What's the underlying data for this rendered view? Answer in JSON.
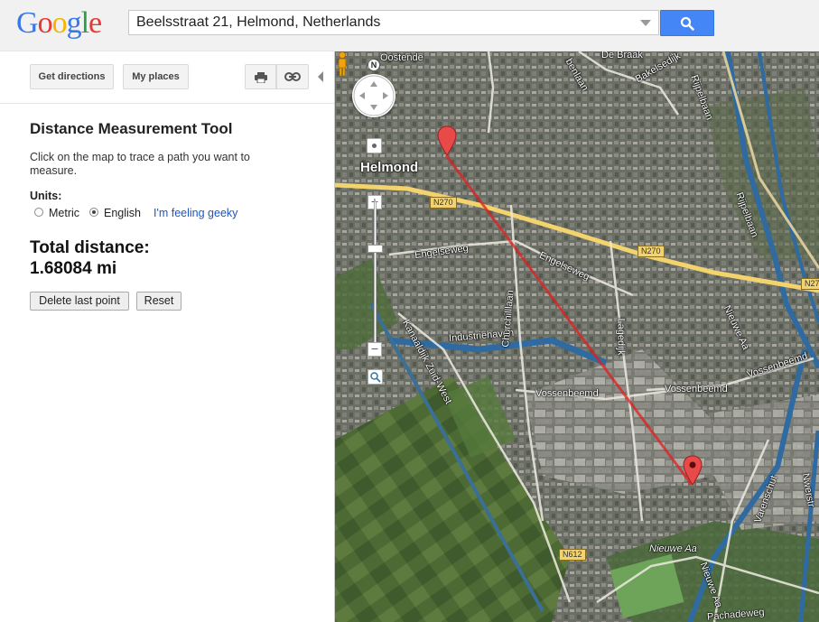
{
  "header": {
    "logo_letters": [
      {
        "char": "G",
        "color": "#3b78e7"
      },
      {
        "char": "o",
        "color": "#e53935"
      },
      {
        "char": "o",
        "color": "#f5b400"
      },
      {
        "char": "g",
        "color": "#3b78e7"
      },
      {
        "char": "l",
        "color": "#2e9e45"
      },
      {
        "char": "e",
        "color": "#e53935"
      }
    ],
    "search_value": "Beelsstraat 21, Helmond, Netherlands",
    "search_button_icon": "search-icon"
  },
  "panel": {
    "get_directions_label": "Get directions",
    "my_places_label": "My places",
    "print_icon": "printer-icon",
    "link_icon": "link-icon",
    "tool_title": "Distance Measurement Tool",
    "instructions": "Click on the map to trace a path you want to measure.",
    "units_label": "Units:",
    "unit_options": [
      "Metric",
      "English"
    ],
    "unit_selected": "English",
    "geeky_link": "I'm feeling geeky",
    "total_label": "Total distance:",
    "total_value": "1.68084 mi",
    "delete_last_label": "Delete last point",
    "reset_label": "Reset"
  },
  "map": {
    "compass_label": "N",
    "zoom_in_symbol": "+",
    "zoom_out_symbol": "−",
    "labels": {
      "oostende": "Oostende",
      "helmond": "Helmond",
      "n270a": "N270",
      "n270b": "N270",
      "n27": "N27",
      "engelseweg1": "Engelseweg",
      "engelseweg2": "Engelseweg",
      "industriehaven": "Industriehaven",
      "churchilllaan": "Churchilllaan",
      "lagedijk": "Lagedijk",
      "kanaal": "Kanaaldijk Zuid-West",
      "vossenbeemd1": "Vossenbeemd",
      "vossenbeemd2": "Vossenbeemd",
      "vossenbeemd3": "Vossenbeemd",
      "nieuweaa1": "Nieuwe Aa",
      "nieuweaa2": "Nieuwe Aa",
      "nieuweaa3": "Nieuwe Aa",
      "ripselbaan1": "Rijpelbaan",
      "ripselbaan2": "Rijpelbaan",
      "debraak": "De Braak",
      "bakelsedijk": "Bakelsedijk",
      "benlaan": "benlaan",
      "varenschut": "Varenschut",
      "nweerstr": "Nwerstr",
      "n612": "N612",
      "pachadeweg": "Pachadeweg"
    },
    "colors": {
      "measure_line": "#e02020",
      "marker": "#e84a4a",
      "road": "#f3d36d",
      "water": "#2f6aa0"
    }
  }
}
